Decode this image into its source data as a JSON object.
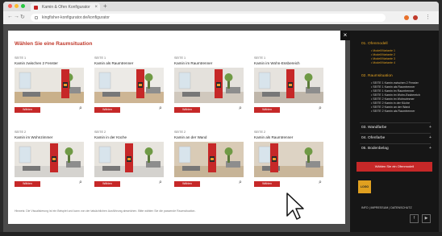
{
  "browser": {
    "tab_title": "Kamin & Ofen Konfigurator",
    "new_tab": "+",
    "tab_close": "×",
    "url": "kingfisher-konfigurator.de/konfigurator",
    "back": "←",
    "forward": "→",
    "reload": "↻",
    "home": "⌂",
    "menu": "⋮",
    "dot_colors": [
      "#ff5f57",
      "#febc2e",
      "#28c840"
    ]
  },
  "modal": {
    "title": "Wählen Sie eine Raumsituation",
    "close": "×",
    "footnote": "Hinweis: Die Visualisierung ist ein Beispiel und kann von der tatsächlichen Ausführung abweichen. Bitte wählen Sie die passende Raumsituation.",
    "button_label": "Wählen",
    "zoom_icon": "⌕",
    "cards": [
      {
        "kicker": "SEITE 1",
        "title": "Kamin zwischen 2 Fenster",
        "wall": "#e9e6e0",
        "floor": "#c9b08a"
      },
      {
        "kicker": "SEITE 1",
        "title": "Kamin als Raumtrenner",
        "wall": "#eceae6",
        "floor": "#cdb594"
      },
      {
        "kicker": "SEITE 1",
        "title": "Kamin im Raumtrenner",
        "wall": "#e4e1dc",
        "floor": "#d0c8bd"
      },
      {
        "kicker": "SEITE 1",
        "title": "Kamin im Wohn-Essbereich",
        "wall": "#e6e3de",
        "floor": "#bfb6aa"
      },
      {
        "kicker": "SEITE 2",
        "title": "Kamin im Wohnzimmer",
        "wall": "#e8e5df",
        "floor": "#d5d3cf"
      },
      {
        "kicker": "SEITE 2",
        "title": "Kamin in der Küche",
        "wall": "#e7e4de",
        "floor": "#d4d2ce"
      },
      {
        "kicker": "SEITE 2",
        "title": "Kamin an der Wand",
        "wall": "#d9cbb6",
        "floor": "#c7b497"
      },
      {
        "kicker": "SEITE 2",
        "title": "Kamin als Raumtrenner",
        "wall": "#ddd3c4",
        "floor": "#c9b69a"
      }
    ]
  },
  "sidebar": {
    "section1": "01. Ofenmodell",
    "section1_items": [
      "• Modell/Variante 1",
      "• Modell/Variante 2",
      "• Modell/Variante 3",
      "• Modell/Variante 4"
    ],
    "section2": "02. Raumsituation",
    "section2_items": [
      "• SEITE 1 Kamin zwischen 2 Fenster",
      "• SEITE 1 Kamin als Raumtrenner",
      "• SEITE 1 Kamin im Raumtrenner",
      "• SEITE 1 Kamin im Wohn-Essbereich",
      "• SEITE 2 Kamin im Wohnzimmer",
      "• SEITE 2 Kamin in der Küche",
      "• SEITE 2 Kamin an der Wand",
      "• SEITE 2 Kamin als Raumtrenner"
    ],
    "section3": "03. Wandfarbe",
    "section4": "04. Ofenfarbe",
    "section5": "05. Bodenbelag",
    "plus": "+",
    "cta": "Wählen Sie ein Ofenmodell",
    "logo": "LOGO",
    "contact": "INFO | IMPRESSUM | DATENSCHUTZ",
    "social": [
      "f",
      "▶"
    ]
  },
  "colors": {
    "accent": "#c62828",
    "title_red": "#c0392b",
    "sidebar_bg": "#161616",
    "highlight": "#e0a020"
  }
}
